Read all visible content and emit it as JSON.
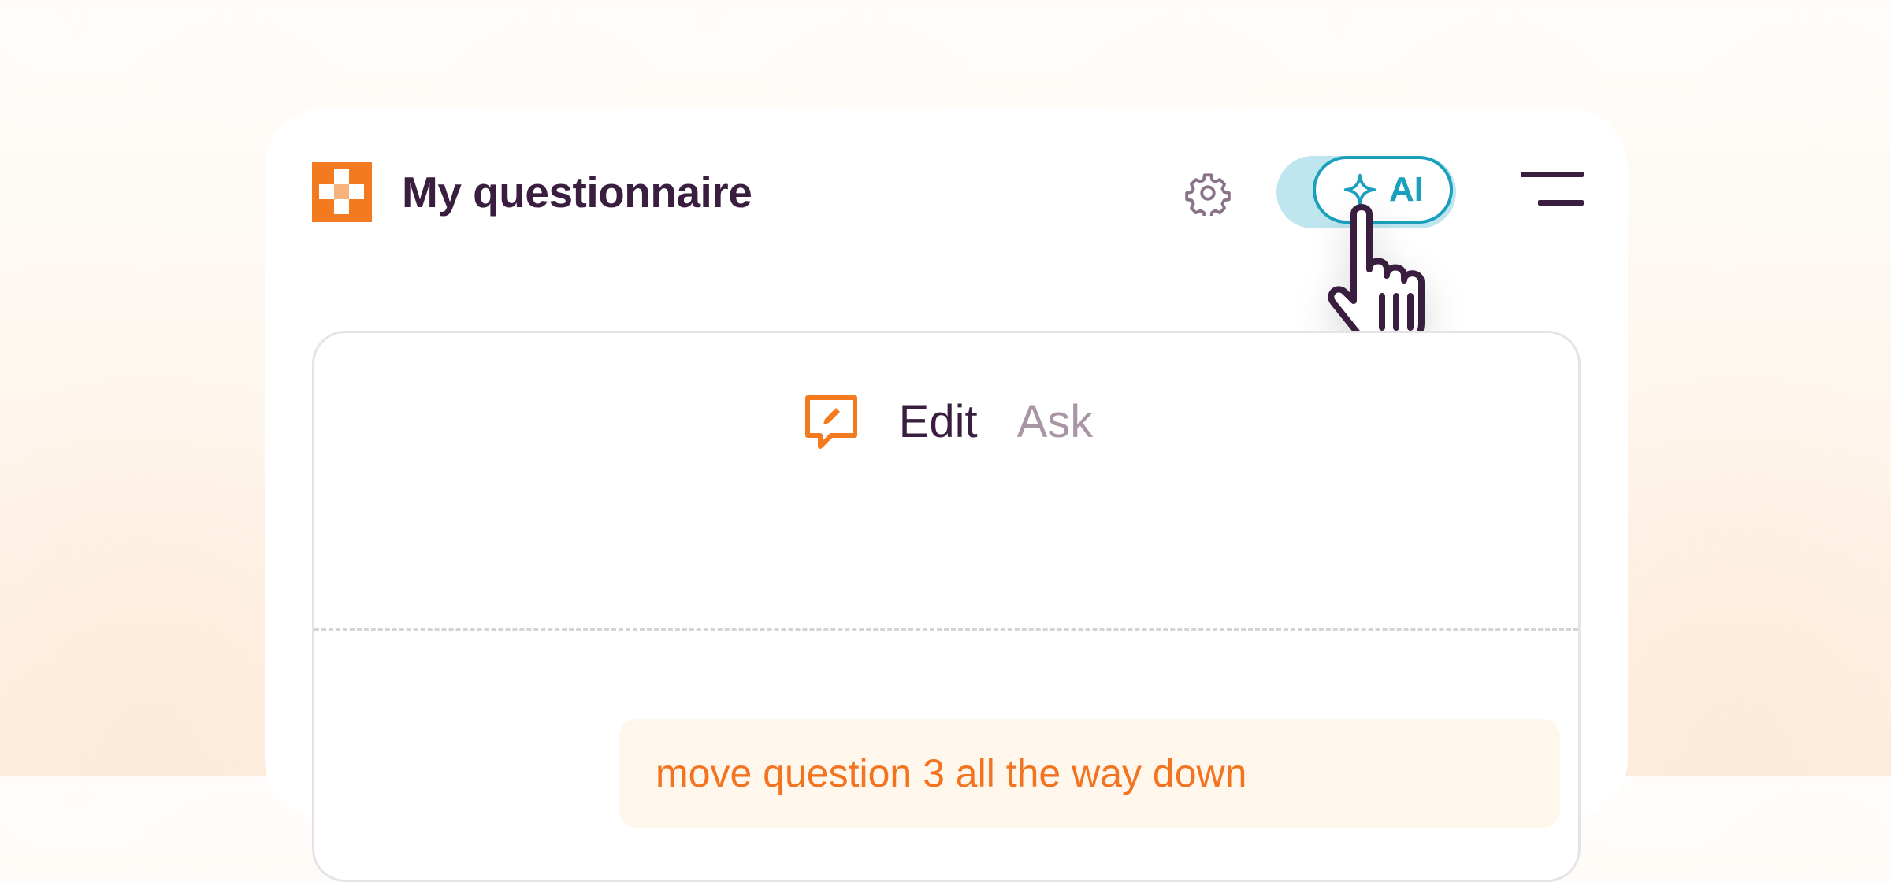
{
  "header": {
    "title": "My questionnaire",
    "logo_icon": "brand-logo-icon",
    "settings_icon": "gear-icon",
    "ai_toggle": {
      "label": "AI",
      "icon": "sparkle-icon",
      "state": "on"
    },
    "menu_icon": "hamburger-menu-icon"
  },
  "chat": {
    "mode_icon": "chat-edit-icon",
    "tabs": [
      {
        "label": "Edit",
        "active": true
      },
      {
        "label": "Ask",
        "active": false
      }
    ],
    "messages": [
      {
        "role": "user",
        "text": "move question 3 all the way down"
      }
    ]
  },
  "colors": {
    "brand_orange": "#f47a20",
    "accent_teal": "#1aa0bd",
    "toggle_track": "#bfe5ee",
    "text_dark": "#3a1e3f",
    "text_muted": "#a895a6",
    "message_bg": "#fff6ec"
  }
}
